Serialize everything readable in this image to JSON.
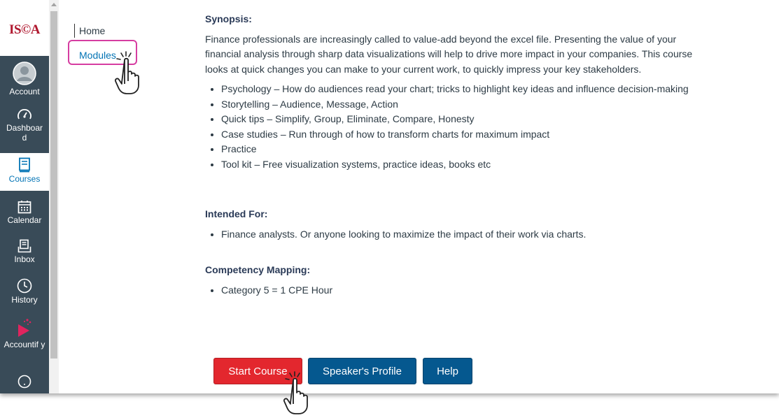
{
  "global_nav": {
    "logo": "IS©A",
    "items": [
      {
        "label": "Account",
        "icon": "account-icon"
      },
      {
        "label": "Dashboar d",
        "icon": "dashboard-icon"
      },
      {
        "label": "Courses",
        "icon": "courses-icon",
        "active": true
      },
      {
        "label": "Calendar",
        "icon": "calendar-icon"
      },
      {
        "label": "Inbox",
        "icon": "inbox-icon"
      },
      {
        "label": "History",
        "icon": "history-icon"
      },
      {
        "label": "Accountif y",
        "icon": "accountify-icon"
      }
    ]
  },
  "course_nav": {
    "home": "Home",
    "modules": "Modules"
  },
  "content": {
    "synopsis_heading": "Synopsis:",
    "synopsis_text": "Finance professionals are increasingly called to value-add beyond the excel file. Presenting the value of your financial analysis through sharp data visualizations will help to drive more impact in your companies. This course looks at quick changes you can make to your current work, to quickly impress your key stakeholders.",
    "synopsis_items": [
      "Psychology – How do audiences read your chart; tricks to highlight key ideas and influence decision-making",
      "Storytelling – Audience, Message, Action",
      "Quick tips – Simplify, Group, Eliminate, Compare, Honesty",
      "Case studies – Run through of how to transform charts for maximum impact",
      "Practice",
      "Tool kit – Free visualization systems, practice ideas, books etc"
    ],
    "intended_heading": "Intended For:",
    "intended_items": [
      "Finance analysts. Or anyone looking to maximize the impact of their work via charts."
    ],
    "competency_heading": "Competency Mapping:",
    "competency_items": [
      "Category 5 = 1 CPE Hour"
    ]
  },
  "buttons": {
    "start": "Start Course",
    "speaker": "Speaker's Profile",
    "help": "Help"
  },
  "colors": {
    "nav_bg": "#394b58",
    "link": "#0374b5",
    "start_button": "#e3272e",
    "secondary_button": "#05588f",
    "highlight": "#d63da1"
  }
}
